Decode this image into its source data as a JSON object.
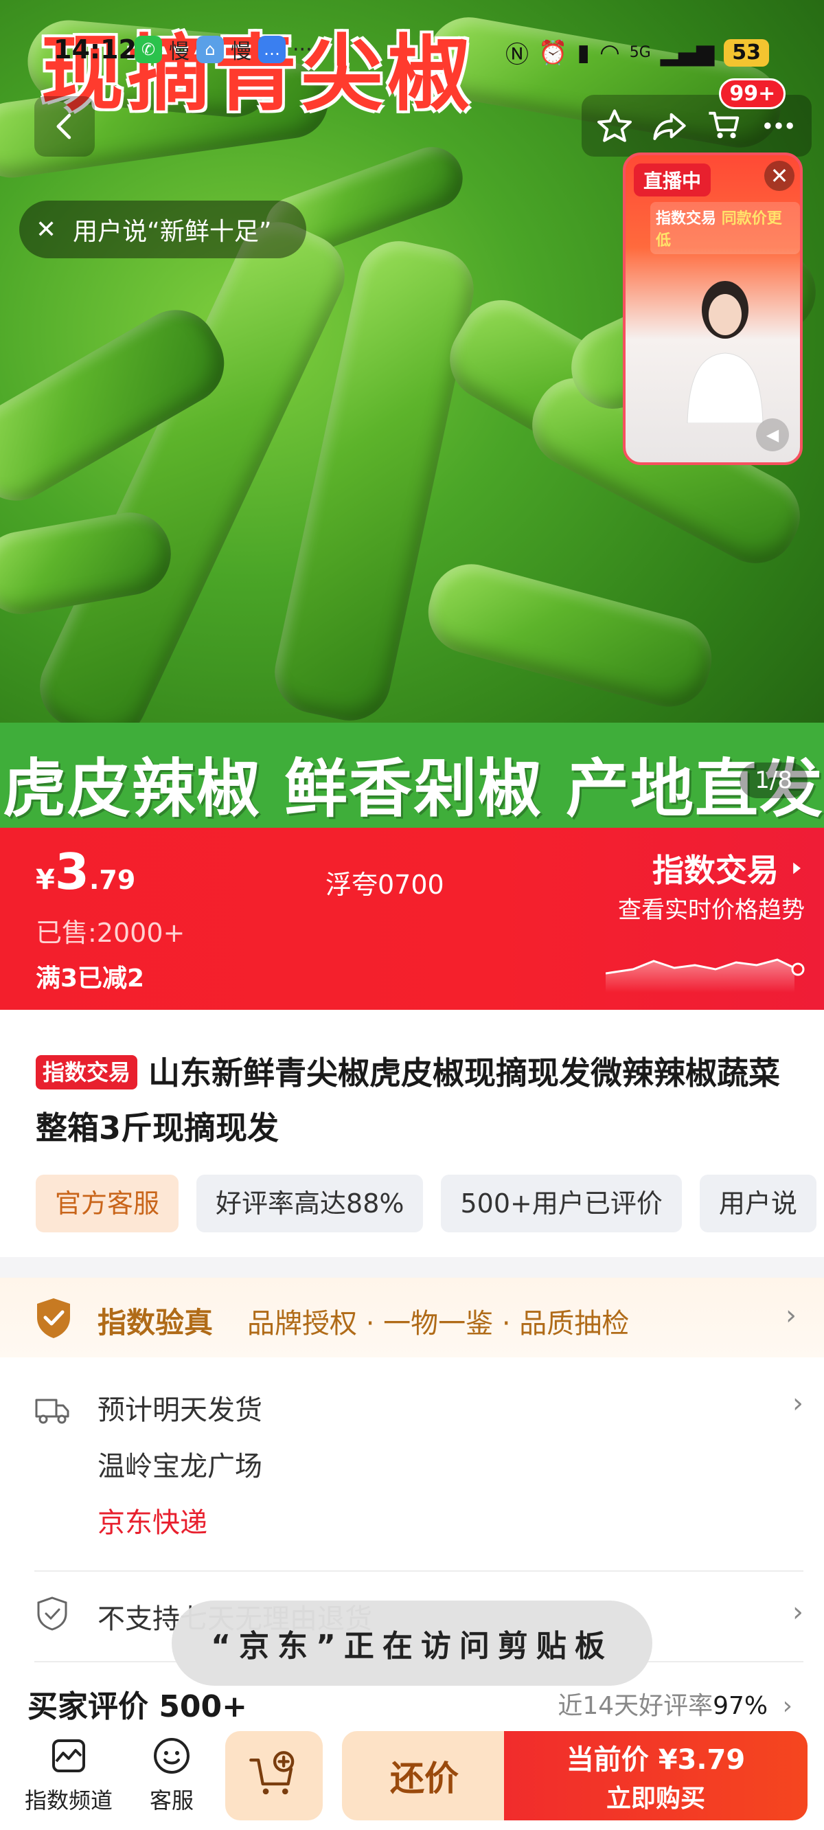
{
  "status_bar": {
    "time": "14:12",
    "app_label_1": "慢",
    "app_label_2": "慢",
    "more": "···",
    "network": "5G",
    "battery": "53"
  },
  "hero": {
    "title": "现摘青尖椒",
    "banner": "虎皮辣椒  鲜香剁椒  产地直发",
    "page_indicator": "1/8"
  },
  "nav": {
    "back_icon": "chevron-left-icon",
    "cart_badge": "99+"
  },
  "tip": {
    "text": "用户说“新鲜十足”"
  },
  "live": {
    "badge": "直播中",
    "banner_prefix": "指数交易",
    "banner_highlight": "同款价更低"
  },
  "price": {
    "currency": "¥",
    "integer": "3",
    "decimal": ".79",
    "tag": "浮夸0700",
    "sold": "已售:2000+",
    "promo": "满3已减2",
    "index_title": "指数交易",
    "index_sub": "查看实时价格趋势"
  },
  "product": {
    "badge": "指数交易",
    "title": "山东新鲜青尖椒虎皮椒现摘现发微辣辣椒蔬菜 整箱3斤现摘现发",
    "tags": [
      "官方客服",
      "好评率高达88%",
      "500+用户已评价",
      "用户说"
    ]
  },
  "auth": {
    "title": "指数验真",
    "items": "品牌授权 · 一物一鉴 · 品质抽检"
  },
  "shipping": {
    "eta": "预计明天发货",
    "location": "温岭宝龙广场",
    "carrier": "京东快递",
    "return_policy": "不支持七天无理由退货"
  },
  "reviews": {
    "heading": "买家评价 500+",
    "rate_label": "近14天好评率",
    "rate_value": "97%"
  },
  "toast": {
    "text": "“京东”正在访问剪贴板"
  },
  "bottom_bar": {
    "channel_label": "指数频道",
    "service_label": "客服",
    "bargain_label": "还价",
    "buy_price": "当前价 ¥3.79",
    "buy_label": "立即购买"
  },
  "colors": {
    "brand_red": "#f31f2c",
    "auth_brown": "#b06b18",
    "bargain_bg": "#fde2c6"
  }
}
